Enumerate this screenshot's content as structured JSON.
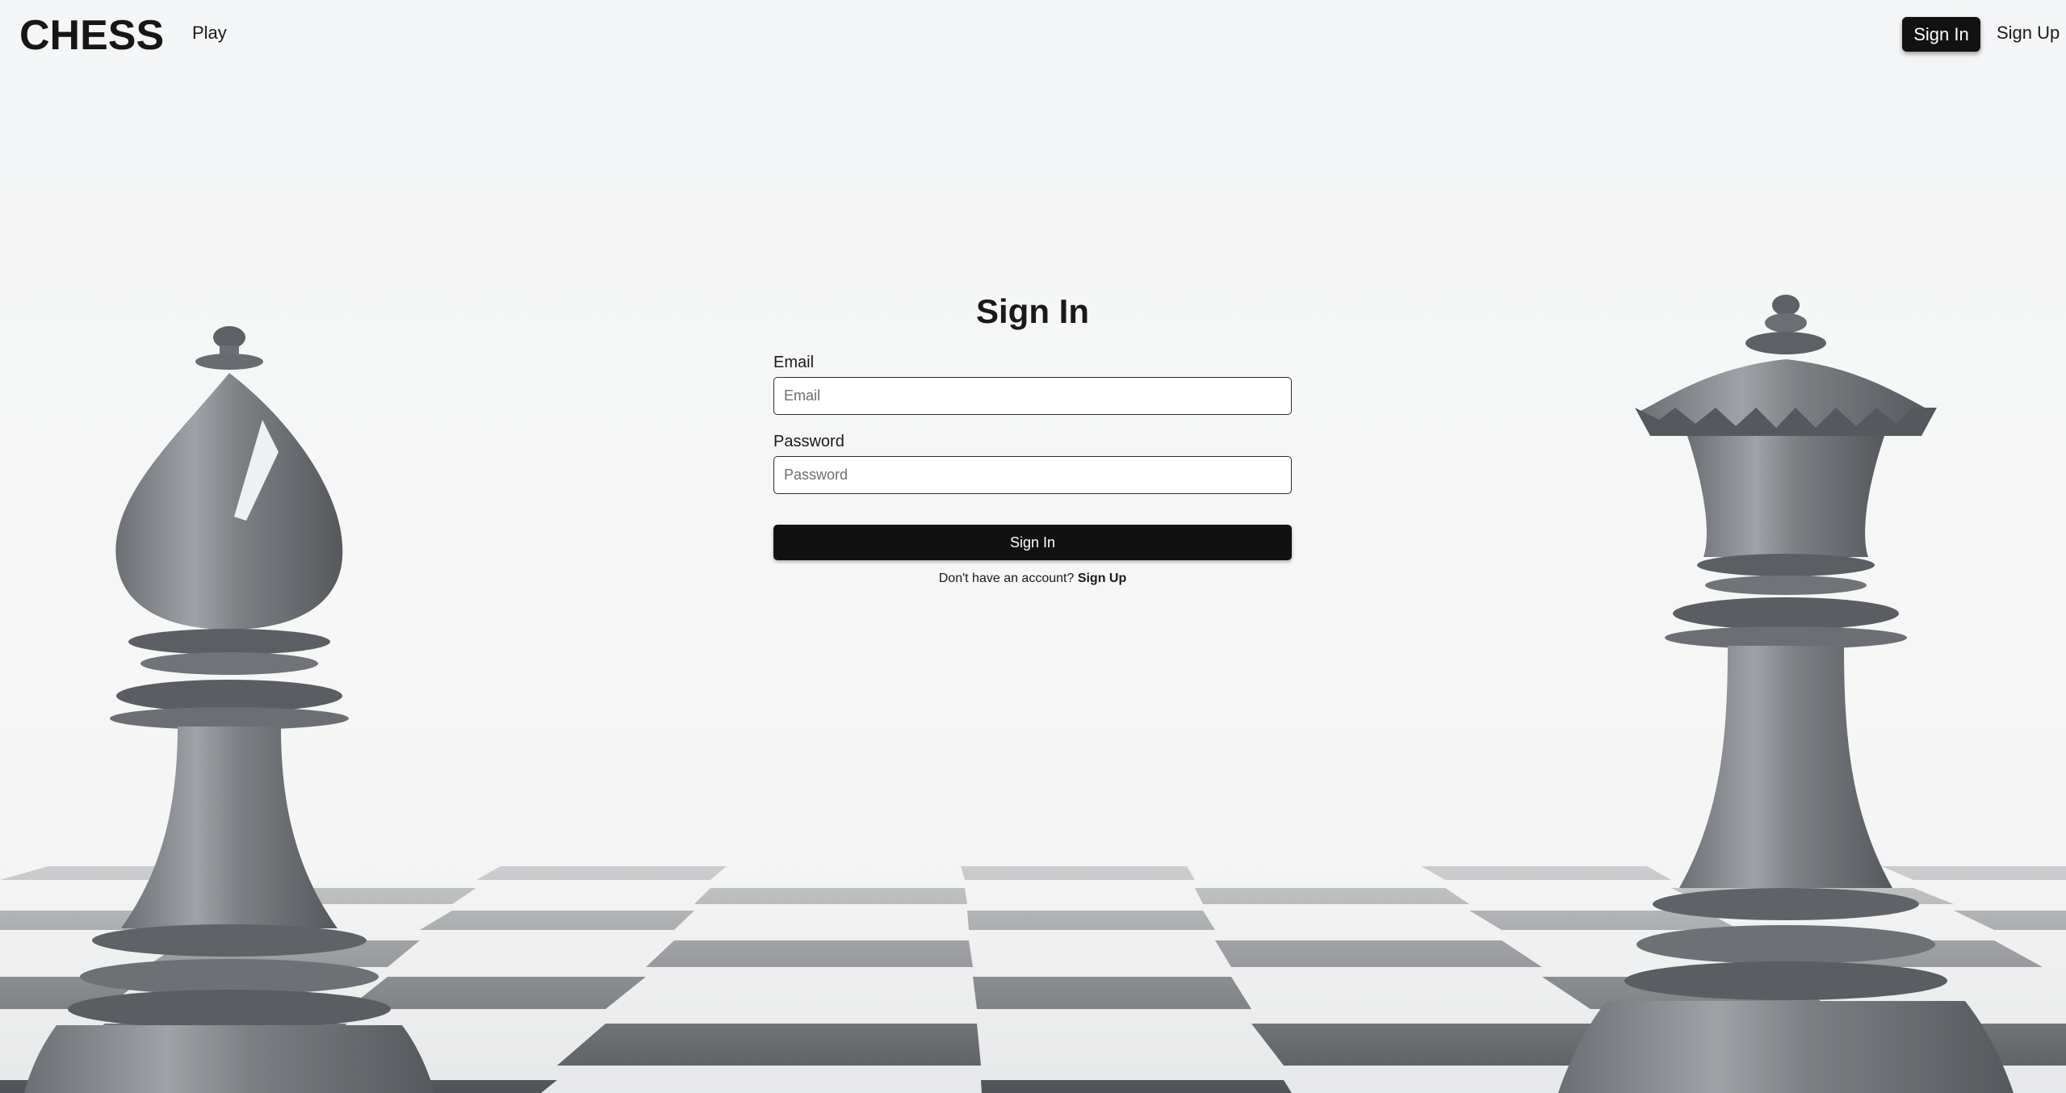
{
  "header": {
    "logo": "CHESS",
    "nav_play": "Play",
    "signin_label": "Sign In",
    "signup_label": "Sign Up"
  },
  "form": {
    "title": "Sign In",
    "email_label": "Email",
    "email_placeholder": "Email",
    "email_value": "",
    "password_label": "Password",
    "password_placeholder": "Password",
    "password_value": "",
    "submit_label": "Sign In",
    "switch_prompt": "Don't have an account?",
    "switch_link": "Sign Up"
  },
  "colors": {
    "background": "#f4f5f6",
    "primary_button": "#111111",
    "text": "#1a1a1a"
  },
  "background_image": {
    "pieces": [
      "bishop",
      "queen"
    ],
    "board": "checkerboard"
  }
}
